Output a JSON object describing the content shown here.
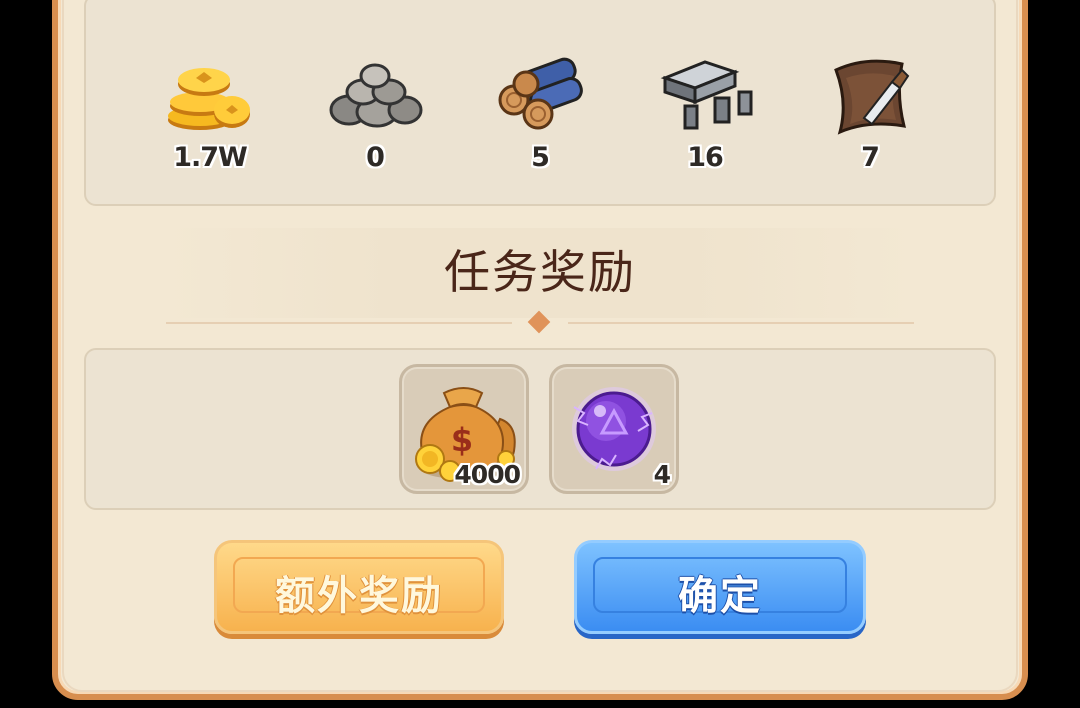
{
  "resources": [
    {
      "icon": "gold-coins-icon",
      "count": "1.7W"
    },
    {
      "icon": "stone-pile-icon",
      "count": "0"
    },
    {
      "icon": "wood-logs-icon",
      "count": "5"
    },
    {
      "icon": "iron-ingots-icon",
      "count": "16"
    },
    {
      "icon": "leather-hide-icon",
      "count": "7"
    }
  ],
  "rewards_section": {
    "title": "任务奖励",
    "items": [
      {
        "icon": "money-bag-icon",
        "count": "4000"
      },
      {
        "icon": "purple-orb-icon",
        "count": "4"
      }
    ]
  },
  "buttons": {
    "extra_reward": "额外奖励",
    "confirm": "确定"
  },
  "colors": {
    "panel_bg": "#f3e8d3",
    "panel_border": "#d78e4f",
    "extra_button": "#f7b24e",
    "confirm_button": "#3b8df2",
    "title_text": "#4a2619"
  }
}
